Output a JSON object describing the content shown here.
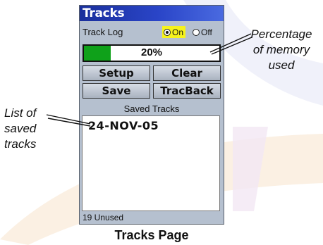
{
  "screen": {
    "title": "Tracks",
    "track_log": {
      "label": "Track Log",
      "options": [
        "On",
        "Off"
      ],
      "selected": "On"
    },
    "memory": {
      "percent_text": "20%",
      "fraction": 0.2,
      "fill_color": "#0fa11a"
    },
    "buttons": {
      "setup": "Setup",
      "clear": "Clear",
      "save": "Save",
      "tracback": "TracBack"
    },
    "saved_tracks": {
      "header": "Saved Tracks",
      "items": [
        "24-NOV-05"
      ]
    },
    "status": "19 Unused"
  },
  "callouts": {
    "left": [
      "List of",
      "saved",
      "tracks"
    ],
    "right": [
      "Percentage",
      "of memory",
      "used"
    ]
  },
  "caption": "Tracks Page",
  "colors": {
    "title_bar": "#1a2f9c",
    "selected_highlight": "#f6f21c",
    "screen_bg": "#b5c0cf"
  }
}
